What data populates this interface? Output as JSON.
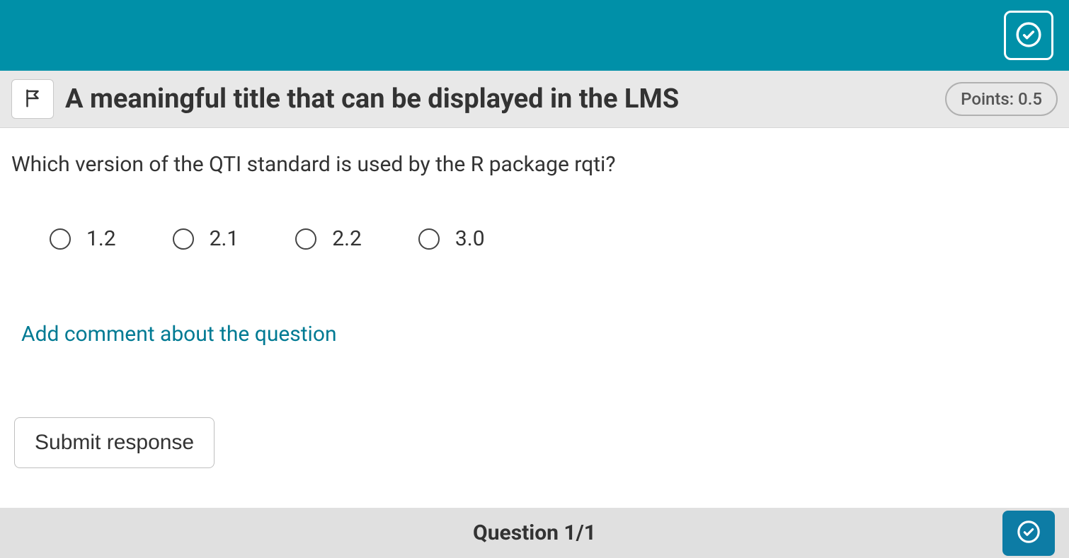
{
  "header": {
    "title": "A meaningful title that can be displayed in the LMS",
    "points_label": "Points: 0.5"
  },
  "question": {
    "prompt": "Which version of the QTI standard is used by the R package rqti?",
    "options": [
      "1.2",
      "2.1",
      "2.2",
      "3.0"
    ]
  },
  "actions": {
    "add_comment": "Add comment about the question",
    "submit": "Submit response"
  },
  "footer": {
    "pagination": "Question 1/1"
  }
}
